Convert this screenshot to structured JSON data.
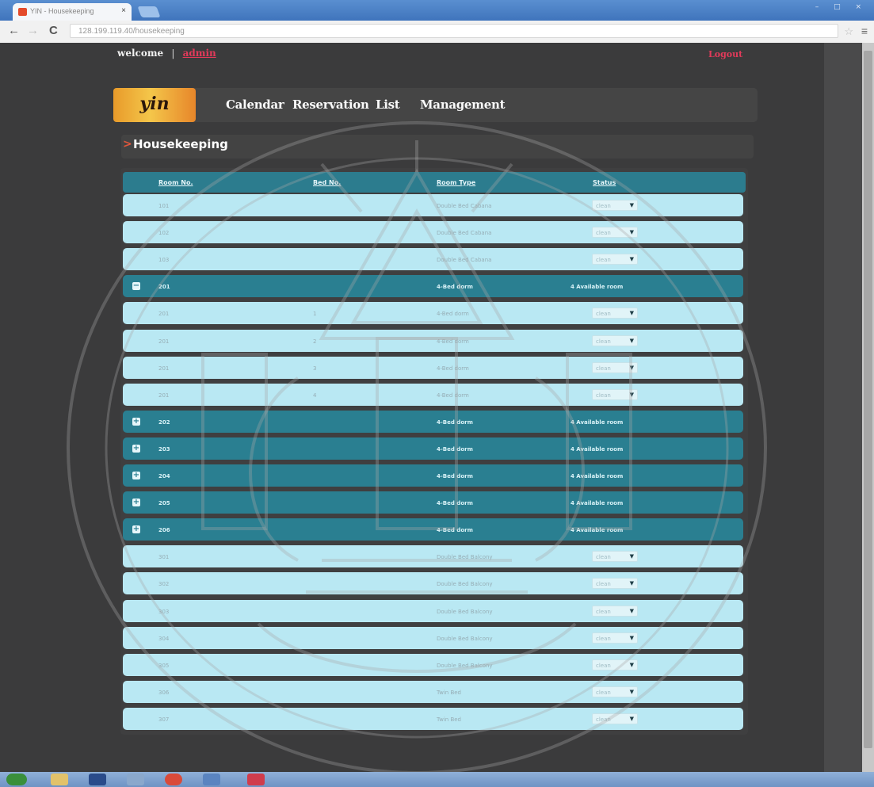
{
  "browser": {
    "tab_title": "YIN - Housekeeping",
    "tab_close": "×",
    "url": "128.199.119.40/housekeeping",
    "window_controls": "– □ ×",
    "back": "←",
    "forward": "→",
    "reload": "C",
    "bookmark_star": "☆",
    "menu": "≡"
  },
  "header": {
    "welcome_label": "welcome",
    "separator": "|",
    "username": "admin",
    "logout_label": "Logout"
  },
  "navbar": {
    "logo_text": "yin",
    "items": [
      {
        "label": "Calendar"
      },
      {
        "label": "Reservation"
      },
      {
        "label": "List"
      },
      {
        "label": "Management"
      }
    ]
  },
  "breadcrumb": {
    "chevron": ">",
    "title": "Housekeeping"
  },
  "table": {
    "columns": [
      "Room No.",
      "Bed No.",
      "Room Type",
      "Status"
    ],
    "rows": [
      {
        "kind": "room",
        "room": "101",
        "bed": "",
        "type": "Double Bed Cabana",
        "status": "clean"
      },
      {
        "kind": "room",
        "room": "102",
        "bed": "",
        "type": "Double Bed Cabana",
        "status": "clean"
      },
      {
        "kind": "room",
        "room": "103",
        "bed": "",
        "type": "Double Bed Cabana",
        "status": "clean"
      },
      {
        "kind": "group",
        "expander": "−",
        "room": "201",
        "type": "4-Bed dorm",
        "summary": "4 Available room"
      },
      {
        "kind": "room",
        "room": "201",
        "bed": "1",
        "type": "4-Bed dorm",
        "status": "clean"
      },
      {
        "kind": "room",
        "room": "201",
        "bed": "2",
        "type": "4-Bed dorm",
        "status": "clean"
      },
      {
        "kind": "room",
        "room": "201",
        "bed": "3",
        "type": "4-Bed dorm",
        "status": "clean"
      },
      {
        "kind": "room",
        "room": "201",
        "bed": "4",
        "type": "4-Bed dorm",
        "status": "clean"
      },
      {
        "kind": "group",
        "expander": "+",
        "room": "202",
        "type": "4-Bed dorm",
        "summary": "4 Available room"
      },
      {
        "kind": "group",
        "expander": "+",
        "room": "203",
        "type": "4-Bed dorm",
        "summary": "4 Available room"
      },
      {
        "kind": "group",
        "expander": "+",
        "room": "204",
        "type": "4-Bed dorm",
        "summary": "4 Available room"
      },
      {
        "kind": "group",
        "expander": "+",
        "room": "205",
        "type": "4-Bed dorm",
        "summary": "4 Available room"
      },
      {
        "kind": "group",
        "expander": "+",
        "room": "206",
        "type": "4-Bed dorm",
        "summary": "4 Available room"
      },
      {
        "kind": "room",
        "room": "301",
        "bed": "",
        "type": "Double Bed Balcony",
        "status": "clean"
      },
      {
        "kind": "room",
        "room": "302",
        "bed": "",
        "type": "Double Bed Balcony",
        "status": "clean"
      },
      {
        "kind": "room",
        "room": "303",
        "bed": "",
        "type": "Double Bed Balcony",
        "status": "clean"
      },
      {
        "kind": "room",
        "room": "304",
        "bed": "",
        "type": "Double Bed Balcony",
        "status": "clean"
      },
      {
        "kind": "room",
        "room": "305",
        "bed": "",
        "type": "Double Bed Balcony",
        "status": "clean"
      },
      {
        "kind": "room",
        "room": "306",
        "bed": "",
        "type": "Twin Bed",
        "status": "clean"
      },
      {
        "kind": "room",
        "room": "307",
        "bed": "",
        "type": "Twin Bed",
        "status": "clean"
      }
    ]
  },
  "colors": {
    "page_bg": "#3b3b3c",
    "header_row": "#2c7c8e",
    "group_row": "#2a7f91",
    "room_row": "#b9e8f3",
    "accent_red": "#e23a5a",
    "logo_orange": "#f0a63a"
  },
  "icons": {
    "expand": "plus-icon",
    "collapse": "minus-icon",
    "dropdown": "caret-down-icon",
    "dropdown_glyph": "▼"
  }
}
